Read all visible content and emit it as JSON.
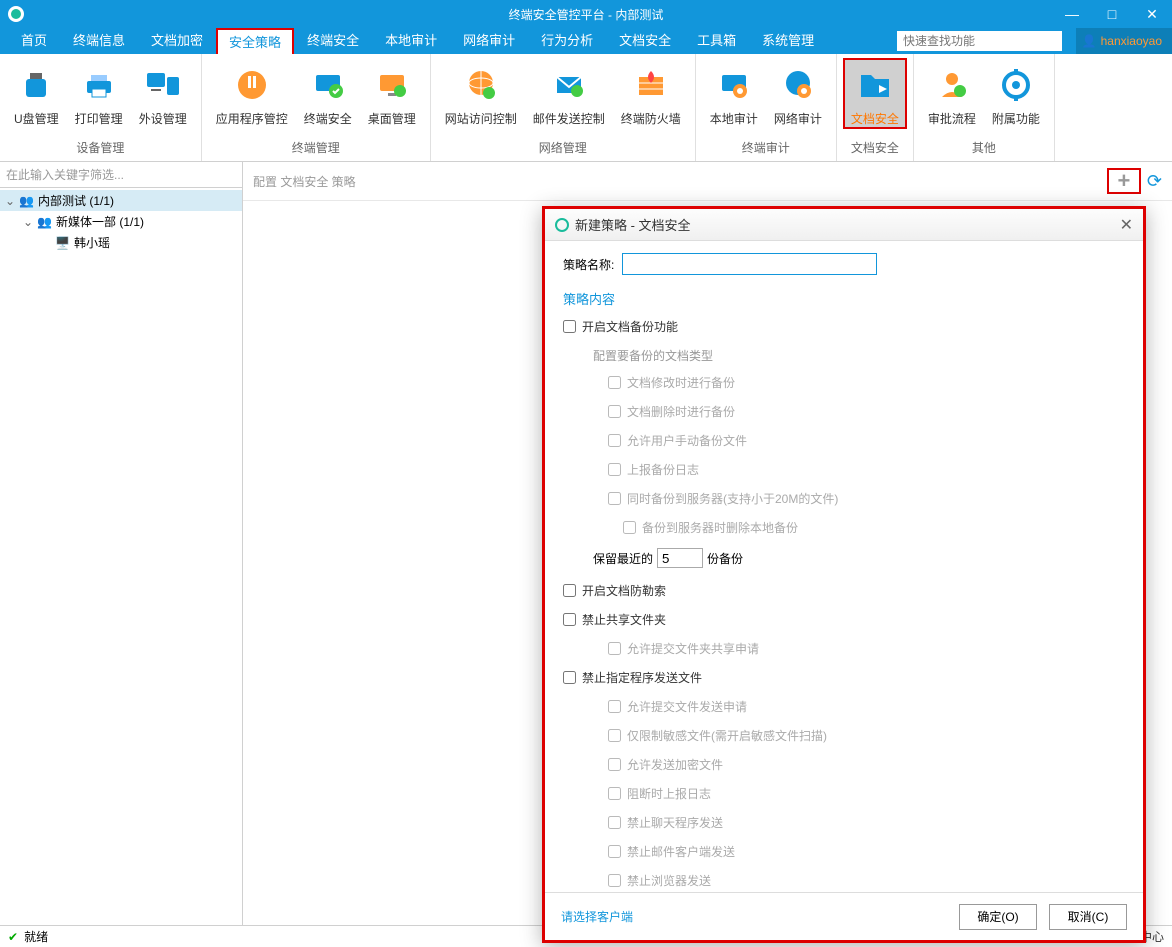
{
  "title": "终端安全管控平台 - 内部测试",
  "win_controls": {
    "min": "—",
    "max": "□",
    "close": "✕"
  },
  "menu": {
    "items": [
      "首页",
      "终端信息",
      "文档加密",
      "安全策略",
      "终端安全",
      "本地审计",
      "网络审计",
      "行为分析",
      "文档安全",
      "工具箱",
      "系统管理"
    ],
    "active_index": 3,
    "search_placeholder": "快速查找功能",
    "user": "hanxiaoyao"
  },
  "ribbon": {
    "groups": [
      {
        "label": "设备管理",
        "items": [
          {
            "name": "usb",
            "label": "U盘管理"
          },
          {
            "name": "print",
            "label": "打印管理"
          },
          {
            "name": "periph",
            "label": "外设管理"
          }
        ]
      },
      {
        "label": "终端管理",
        "items": [
          {
            "name": "appctrl",
            "label": "应用程序管控"
          },
          {
            "name": "termsec",
            "label": "终端安全"
          },
          {
            "name": "desktop",
            "label": "桌面管理"
          }
        ]
      },
      {
        "label": "网络管理",
        "items": [
          {
            "name": "webctrl",
            "label": "网站访问控制"
          },
          {
            "name": "mailctrl",
            "label": "邮件发送控制"
          },
          {
            "name": "firewall",
            "label": "终端防火墙"
          }
        ]
      },
      {
        "label": "终端审计",
        "items": [
          {
            "name": "localaudit",
            "label": "本地审计"
          },
          {
            "name": "netaudit",
            "label": "网络审计"
          }
        ]
      },
      {
        "label": "文档安全",
        "items": [
          {
            "name": "docsec",
            "label": "文档安全",
            "selected": true
          }
        ]
      },
      {
        "label": "其他",
        "items": [
          {
            "name": "approval",
            "label": "审批流程"
          },
          {
            "name": "addon",
            "label": "附属功能"
          }
        ]
      }
    ]
  },
  "tree": {
    "filter_placeholder": "在此输入关键字筛选...",
    "root": {
      "label": "内部测试 (1/1)"
    },
    "child1": {
      "label": "新媒体一部 (1/1)"
    },
    "leaf": {
      "label": "韩小瑶"
    }
  },
  "breadcrumb": "配置 文档安全 策略",
  "status": {
    "text": "就绪",
    "right": "中心"
  },
  "dialog": {
    "title": "新建策略 - 文档安全",
    "policy_name_label": "策略名称:",
    "policy_name_value": "",
    "section_content": "策略内容",
    "chk_backup": "开启文档备份功能",
    "config_types": "配置要备份的文档类型",
    "chk_modify": "文档修改时进行备份",
    "chk_delete": "文档删除时进行备份",
    "chk_manual": "允许用户手动备份文件",
    "chk_uplog": "上报备份日志",
    "chk_sync": "同时备份到服务器(支持小于20M的文件)",
    "chk_delocal": "备份到服务器时删除本地备份",
    "keep_prefix": "保留最近的",
    "keep_value": "5",
    "keep_suffix": "份备份",
    "chk_ransom": "开启文档防勒索",
    "chk_noshare": "禁止共享文件夹",
    "chk_share_req": "允许提交文件夹共享申请",
    "chk_noprog": "禁止指定程序发送文件",
    "chk_send_req": "允许提交文件发送申请",
    "chk_sensitive": "仅限制敏感文件(需开启敏感文件扫描)",
    "chk_allow_enc": "允许发送加密文件",
    "chk_block_log": "阻断时上报日志",
    "chk_no_im": "禁止聊天程序发送",
    "chk_no_mail": "禁止邮件客户端发送",
    "chk_no_browser": "禁止浏览器发送",
    "select_client": "请选择客户端",
    "ok": "确定(O)",
    "cancel": "取消(C)"
  }
}
